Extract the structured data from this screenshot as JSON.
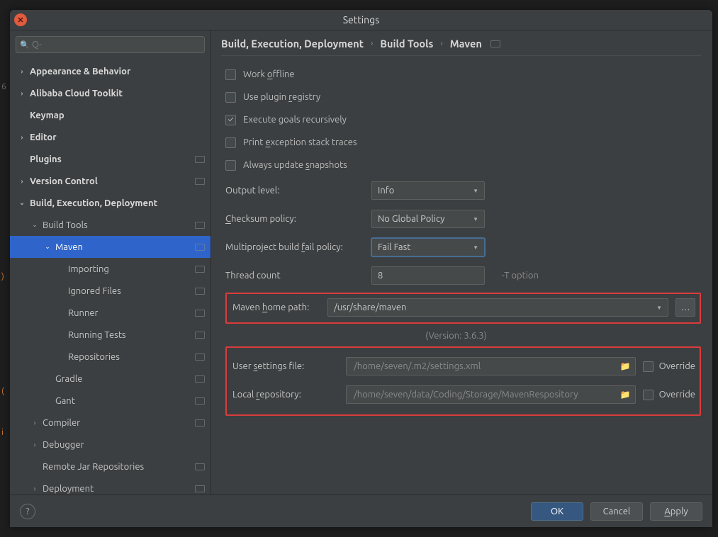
{
  "window": {
    "title": "Settings"
  },
  "search": {
    "placeholder": "Q-"
  },
  "sidebar": {
    "items": [
      {
        "label": "Appearance & Behavior",
        "depth": 0,
        "bold": true,
        "expand": "closed",
        "badge": false
      },
      {
        "label": "Alibaba Cloud Toolkit",
        "depth": 0,
        "bold": true,
        "expand": "closed",
        "badge": false
      },
      {
        "label": "Keymap",
        "depth": 0,
        "bold": true,
        "expand": "none",
        "badge": false
      },
      {
        "label": "Editor",
        "depth": 0,
        "bold": true,
        "expand": "closed",
        "badge": false
      },
      {
        "label": "Plugins",
        "depth": 0,
        "bold": true,
        "expand": "none",
        "badge": true
      },
      {
        "label": "Version Control",
        "depth": 0,
        "bold": true,
        "expand": "closed",
        "badge": true
      },
      {
        "label": "Build, Execution, Deployment",
        "depth": 0,
        "bold": true,
        "expand": "open",
        "badge": false
      },
      {
        "label": "Build Tools",
        "depth": 1,
        "bold": false,
        "expand": "open",
        "badge": true
      },
      {
        "label": "Maven",
        "depth": 2,
        "bold": false,
        "expand": "open",
        "badge": true,
        "selected": true
      },
      {
        "label": "Importing",
        "depth": 3,
        "bold": false,
        "expand": "none",
        "badge": true
      },
      {
        "label": "Ignored Files",
        "depth": 3,
        "bold": false,
        "expand": "none",
        "badge": true
      },
      {
        "label": "Runner",
        "depth": 3,
        "bold": false,
        "expand": "none",
        "badge": true
      },
      {
        "label": "Running Tests",
        "depth": 3,
        "bold": false,
        "expand": "none",
        "badge": true
      },
      {
        "label": "Repositories",
        "depth": 3,
        "bold": false,
        "expand": "none",
        "badge": true
      },
      {
        "label": "Gradle",
        "depth": 2,
        "bold": false,
        "expand": "none",
        "badge": true
      },
      {
        "label": "Gant",
        "depth": 2,
        "bold": false,
        "expand": "none",
        "badge": true
      },
      {
        "label": "Compiler",
        "depth": 1,
        "bold": false,
        "expand": "closed",
        "badge": true
      },
      {
        "label": "Debugger",
        "depth": 1,
        "bold": false,
        "expand": "closed",
        "badge": false
      },
      {
        "label": "Remote Jar Repositories",
        "depth": 1,
        "bold": false,
        "expand": "none",
        "badge": true
      },
      {
        "label": "Deployment",
        "depth": 1,
        "bold": false,
        "expand": "closed",
        "badge": true
      }
    ]
  },
  "breadcrumb": [
    "Build, Execution, Deployment",
    "Build Tools",
    "Maven"
  ],
  "checks": {
    "work_offline": {
      "label_pre": "Work ",
      "u": "o",
      "label_post": "ffline",
      "checked": false
    },
    "use_plugin_reg": {
      "label_pre": "Use plugin ",
      "u": "r",
      "label_post": "egistry",
      "checked": false
    },
    "exec_recursive": {
      "label_pre": "Execute goals recursively",
      "u": "",
      "label_post": "",
      "checked": true
    },
    "print_exception": {
      "label_pre": "Print ",
      "u": "e",
      "label_post": "xception stack traces",
      "checked": false
    },
    "always_snapshot": {
      "label_pre": "Always update ",
      "u": "s",
      "label_post": "napshots",
      "checked": false
    }
  },
  "fields": {
    "output_level": {
      "label": "Output level:",
      "value": "Info"
    },
    "checksum": {
      "label_pre": "",
      "u": "C",
      "label_post": "hecksum policy:",
      "value": "No Global Policy"
    },
    "multiproject": {
      "label_pre": "Multiproject build ",
      "u": "f",
      "label_post": "ail policy:",
      "value": "Fail Fast"
    },
    "thread_count": {
      "label": "Thread count",
      "value": "8",
      "hint": "-T option"
    },
    "maven_home": {
      "label_pre": "Maven ",
      "u": "h",
      "label_post": "ome path:",
      "value": "/usr/share/maven"
    },
    "version": "(Version: 3.6.3)",
    "user_settings": {
      "label_pre": "User ",
      "u": "s",
      "label_post": "ettings file:",
      "value": "/home/seven/.m2/settings.xml",
      "override": "Override",
      "checked": false
    },
    "local_repo": {
      "label_pre": "Local ",
      "u": "r",
      "label_post": "epository:",
      "value": "/home/seven/data/Coding/Storage/MavenRespository",
      "override": "Override",
      "checked": false
    }
  },
  "buttons": {
    "ok": "OK",
    "cancel": "Cancel",
    "apply_u": "A",
    "apply_post": "pply"
  },
  "gutter": [
    "6",
    ")",
    "(",
    "i"
  ]
}
